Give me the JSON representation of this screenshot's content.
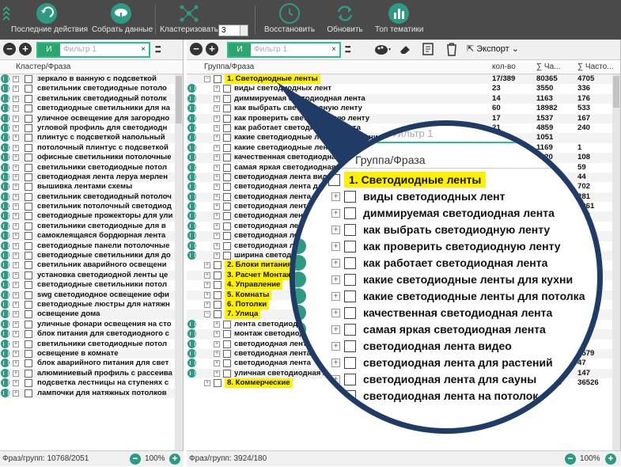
{
  "toolbar": {
    "buttons": [
      {
        "label": "Последние действия",
        "icon": "undo-icon"
      },
      {
        "label": "Собрать данные",
        "icon": "cloud-download-icon"
      },
      {
        "label": "Кластеризовать",
        "icon": "network-icon"
      },
      {
        "label": "Восстановить",
        "icon": "clock-restore-icon"
      },
      {
        "label": "Обновить",
        "icon": "refresh-icon"
      },
      {
        "label": "Топ тематики",
        "icon": "bar-chart-icon"
      }
    ],
    "cluster_value": "3"
  },
  "filter": {
    "and_label": "И",
    "placeholder": "Фильтр 1"
  },
  "left": {
    "column_header": "Кластер/Фраза",
    "rows": [
      "зеркало в ванную с подсветкой",
      "светильник светодиодные потоло",
      "светильник светодиодный потолк",
      "светодиодные светильники для на",
      "уличное освещение для загородно",
      "угловой профиль для светодиодн",
      "плинтус с подсветкой напольный",
      "потолочный плинтус с подсветкой",
      "офисные светильники потолочные",
      "светильники светодиодные потол",
      "светодиодная лента леруа мерлен",
      "вышивка лентами схемы",
      "светильник светодиодный потолоч",
      "светильник потолочный светодиод",
      "светодиодные прожекторы для ули",
      "светильники светодиодные для в",
      "самоклеящаяся бордюрная лента",
      "светодиодные панели потолочные",
      "светодиодные светильники для до",
      "светильник аварийного освещени",
      "установка светодиодной ленты це",
      "светодиодные светильники потол",
      "swg светодиодное освещение офи",
      "светодиодные люстры для натяжн",
      "освещение дома",
      "уличные фонари освещения на сто",
      "блок питания для светодиодного с",
      "светильники светодиодные потол",
      "освещение в комнате",
      "блок аварийного питания для свет",
      "алюминиевый профиль с рассеива",
      "подсветка лестницы на ступенях с",
      "лампочки для натяжных потолков"
    ],
    "status": "Фраз/групп: 10768/2051",
    "zoom": "100%"
  },
  "right": {
    "toolbar": {
      "export_label": "Экспорт"
    },
    "columns": [
      "Группа/Фраза",
      "кол-во",
      "∑ Ча...",
      "∑ Часто..."
    ],
    "rows": [
      {
        "text": "1. Светодиодные ленты",
        "count": "17/389",
        "sum1": "80365",
        "sum2": "4705"
      },
      {
        "text": "виды светодиодных лент",
        "count": "23",
        "sum1": "3550",
        "sum2": "336"
      },
      {
        "text": "диммируемая светодиодная лента",
        "count": "14",
        "sum1": "1163",
        "sum2": "176"
      },
      {
        "text": "как выбрать светодиодную ленту",
        "count": "60",
        "sum1": "18982",
        "sum2": "533"
      },
      {
        "text": "как проверить светодиодную ленту",
        "count": "17",
        "sum1": "1537",
        "sum2": "167"
      },
      {
        "text": "как работает светодиодная лента",
        "count": "21",
        "sum1": "4859",
        "sum2": "240"
      },
      {
        "text": "какие светодиодные ленты для кухни",
        "count": "",
        "sum1": "1051",
        "sum2": ""
      },
      {
        "text": "какие светодиодные ленты для потолка",
        "count": "",
        "sum1": "1169",
        "sum2": "1"
      },
      {
        "text": "качественная светодиодная лента",
        "count": "",
        "sum1": "1120",
        "sum2": "108"
      },
      {
        "text": "самая яркая светодиодная лента",
        "count": "",
        "sum1": "",
        "sum2": "59"
      },
      {
        "text": "светодиодная лента видео",
        "count": "",
        "sum1": "",
        "sum2": "44"
      },
      {
        "text": "светодиодная лента для растений",
        "count": "",
        "sum1": "",
        "sum2": "702"
      },
      {
        "text": "светодиодная лента для сауны",
        "count": "",
        "sum1": "",
        "sum2": "281"
      },
      {
        "text": "светодиодная лента на потолок",
        "count": "",
        "sum1": "",
        "sum2": "1261"
      },
      {
        "text": "светодиодная лента",
        "count": "",
        "sum1": "",
        "sum2": "108"
      },
      {
        "text": "светодиодная лента",
        "count": "",
        "sum1": "",
        "sum2": "137"
      },
      {
        "text": "светодиодная лента",
        "count": "",
        "sum1": "",
        "sum2": "145"
      },
      {
        "text": "светодиодная лента",
        "count": "",
        "sum1": "",
        "sum2": "359"
      },
      {
        "text": "ширина светодиодной",
        "count": "",
        "sum1": "",
        "sum2": "190"
      },
      {
        "text": "2. Блоки питания",
        "count": "",
        "sum1": "",
        "sum2": "2814"
      },
      {
        "text": "3. Расчет Монтаж",
        "count": "",
        "sum1": "",
        "sum2": "13689"
      },
      {
        "text": "4. Управление",
        "count": "",
        "sum1": "",
        "sum2": "997"
      },
      {
        "text": "5. Комнаты",
        "count": "",
        "sum1": "",
        "sum2": "10538"
      },
      {
        "text": "6. Потолки",
        "count": "",
        "sum1": "",
        "sum2": "13894"
      },
      {
        "text": "7. Улица",
        "count": "",
        "sum1": "",
        "sum2": "1773"
      },
      {
        "text": "лента светодиодная",
        "count": "",
        "sum1": "",
        "sum2": ""
      },
      {
        "text": "монтаж светодиодной",
        "count": "",
        "sum1": "",
        "sum2": ""
      },
      {
        "text": "светодиодная лента 2",
        "count": "",
        "sum1": "",
        "sum2": ""
      },
      {
        "text": "светодиодная лента",
        "count": "",
        "sum1": "18433",
        "sum2": "1579"
      },
      {
        "text": "светодиодная лента",
        "count": "",
        "sum1": "272",
        "sum2": "47"
      },
      {
        "text": "уличная светодиодная лента",
        "count": "",
        "sum1": "1371",
        "sum2": "147"
      },
      {
        "text": "8. Коммерческие",
        "count": "",
        "sum1": "760268",
        "sum2": "36526"
      }
    ],
    "status": "Фраз/групп: 3924/180",
    "zoom": "100%"
  },
  "magnifier": {
    "filter_placeholder": "Фильтр 1",
    "column_header": "Группа/Фраза",
    "rows": [
      "1. Светодиодные ленты",
      "виды светодиодных лент",
      "диммируемая светодиодная лента",
      "как выбрать светодиодную ленту",
      "как проверить светодиодную ленту",
      "как работает светодиодная лента",
      "какие светодиодные ленты для кухни",
      "какие светодиодные ленты для потолка",
      "качественная светодиодная лента",
      "самая яркая светодиодная лента",
      "светодиодная лента видео",
      "светодиодная лента для растений",
      "светодиодная лента для сауны",
      "светодиодная лента на потолок"
    ]
  },
  "colors": {
    "accent": "#2f9a83",
    "highlight": "#fff000",
    "magnifier_border": "#1f3b66",
    "toolbar_bg": "#4a4a4a"
  }
}
